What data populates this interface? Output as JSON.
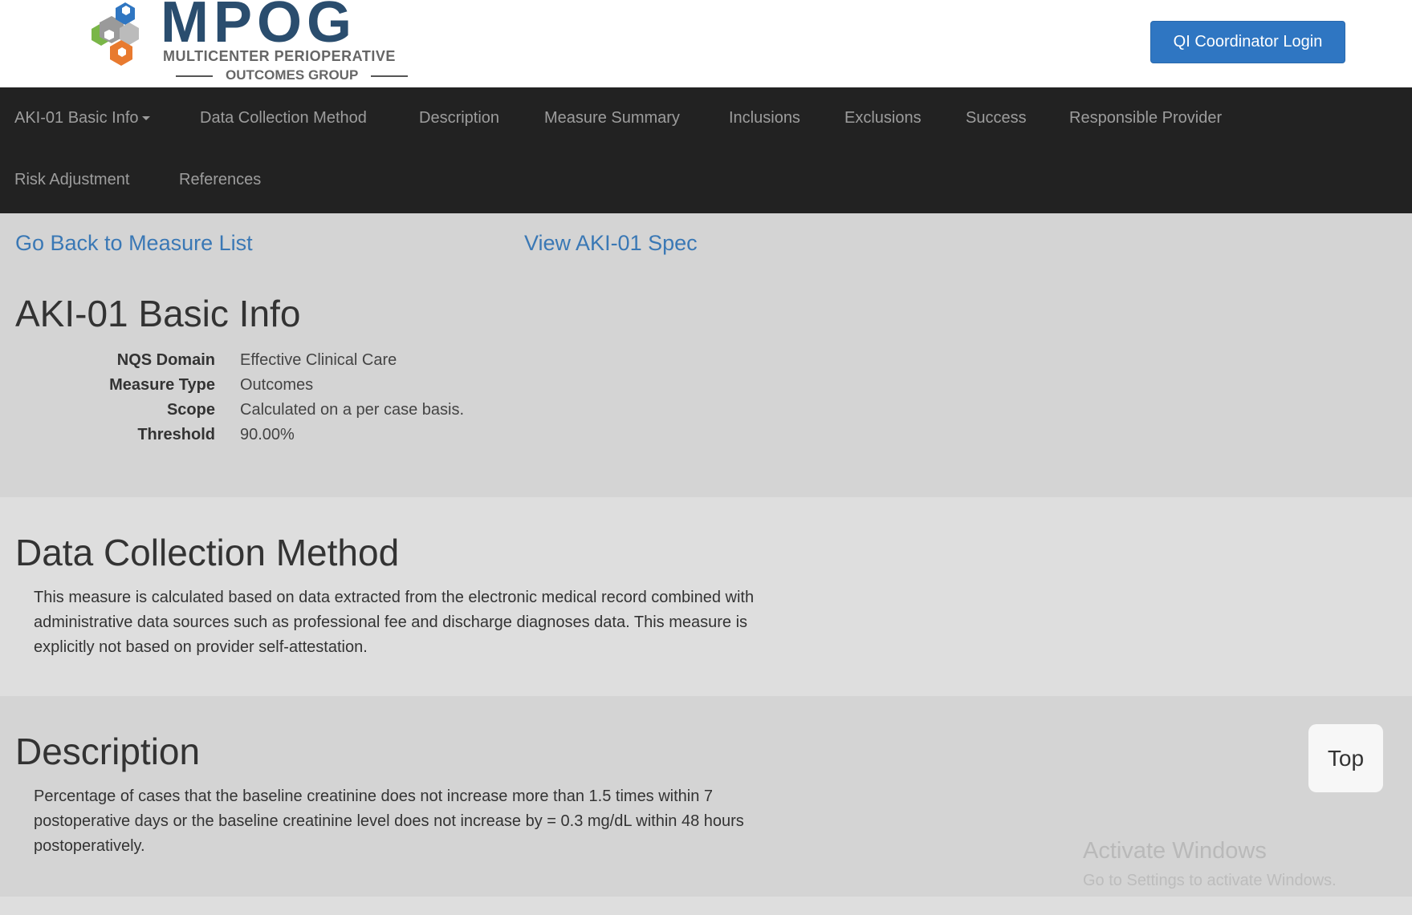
{
  "header": {
    "logo_word": "MPOG",
    "logo_subtitle_1": "MULTICENTER PERIOPERATIVE",
    "logo_subtitle_2": "OUTCOMES GROUP",
    "login_button": "QI Coordinator Login"
  },
  "nav": {
    "items": [
      "AKI-01 Basic Info",
      "Data Collection Method",
      "Description",
      "Measure Summary",
      "Inclusions",
      "Exclusions",
      "Success",
      "Responsible Provider",
      "Risk Adjustment",
      "References"
    ]
  },
  "links": {
    "back": "Go Back to Measure List",
    "spec": "View AKI-01 Spec"
  },
  "basic_info": {
    "title": "AKI-01 Basic Info",
    "rows": [
      {
        "label": "NQS Domain",
        "value": "Effective Clinical Care"
      },
      {
        "label": "Measure Type",
        "value": "Outcomes"
      },
      {
        "label": "Scope",
        "value": "Calculated on a per case basis."
      },
      {
        "label": "Threshold",
        "value": "90.00%"
      }
    ]
  },
  "data_collection": {
    "title": "Data Collection Method",
    "text": "This measure is calculated based on data extracted from the electronic medical record combined with administrative data sources such as professional fee and discharge diagnoses data. This measure is explicitly not based on provider self-attestation."
  },
  "description": {
    "title": "Description",
    "text": "Percentage of cases that the baseline creatinine does not increase more than 1.5 times within 7 postoperative days or the baseline creatinine level does not increase by = 0.3 mg/dL within 48 hours postoperatively."
  },
  "top_button": "Top",
  "watermark": {
    "line1": "Activate Windows",
    "line2": "Go to Settings to activate Windows."
  },
  "colors": {
    "accent": "#2f76c2",
    "link": "#3a78b5",
    "navbar": "#222222",
    "logo_blue": "#2a4d6e",
    "logo_green": "#7ab648",
    "logo_orange": "#e87a2f"
  }
}
